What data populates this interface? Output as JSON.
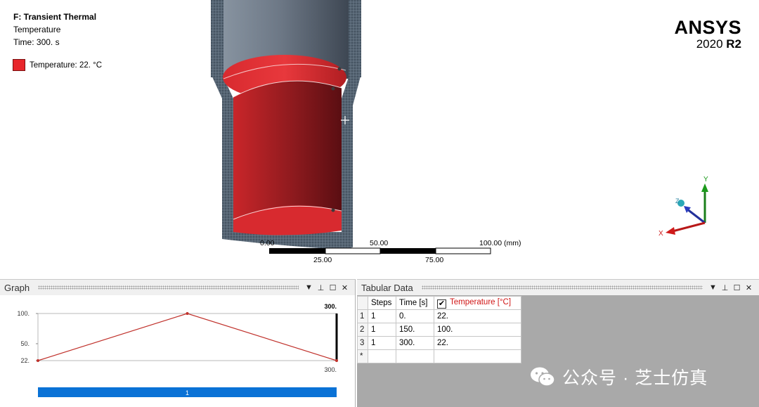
{
  "viewport": {
    "analysis_title": "F: Transient Thermal",
    "result_name": "Temperature",
    "time_label": "Time: 300. s",
    "legend_label": "Temperature: 22. °C",
    "legend_color": "#e8262b",
    "brand": "ANSYS",
    "version_year": "2020",
    "version_release": "R2",
    "scale_bar": {
      "top_labels": [
        "0.00",
        "50.00",
        "100.00 (mm)"
      ],
      "bottom_labels": [
        "25.00",
        "75.00"
      ]
    },
    "triad": {
      "y_label": "Y",
      "z_label": "Z",
      "x_label": "X"
    }
  },
  "graph_panel": {
    "title": "Graph",
    "controls": [
      "▼",
      "📌",
      "☐",
      "✕"
    ]
  },
  "tabular_panel": {
    "title": "Tabular Data",
    "columns": [
      "Steps",
      "Time [s]",
      "Temperature [°C]"
    ],
    "rows": [
      {
        "index": "1",
        "steps": "1",
        "time": "0.",
        "temperature": "22."
      },
      {
        "index": "2",
        "steps": "1",
        "time": "150.",
        "temperature": "100."
      },
      {
        "index": "3",
        "steps": "1",
        "time": "300.",
        "temperature": "22."
      }
    ],
    "new_row_marker": "*",
    "temperature_checked": true
  },
  "chart_data": {
    "type": "line",
    "x": [
      0,
      150,
      300
    ],
    "y": [
      22,
      100,
      22
    ],
    "xlim": [
      0,
      300
    ],
    "ylim": [
      22,
      100
    ],
    "y_tick_labels": [
      "100.",
      "50.",
      "22."
    ],
    "x_tick_labels": [
      "300."
    ],
    "current_time_label": "300.",
    "step_bar_label": "1",
    "line_color": "#c0312b"
  },
  "watermark": {
    "text": "公众号 · 芝士仿真"
  }
}
